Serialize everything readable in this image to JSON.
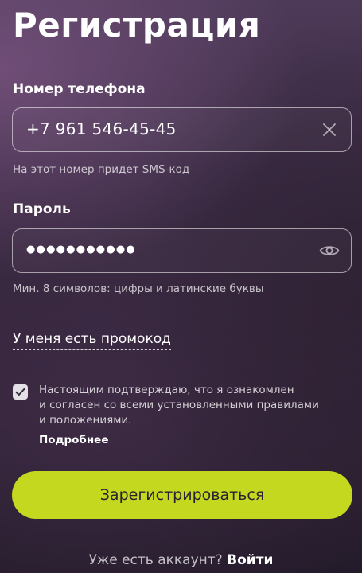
{
  "page": {
    "title": "Регистрация"
  },
  "phone": {
    "label": "Номер телефона",
    "value": "+7 961 546-45-45",
    "hint": "На этот номер придет SMS-код",
    "clear_icon": "close-icon"
  },
  "password": {
    "label": "Пароль",
    "masked_value": "●●●●●●●●●●●",
    "hint": "Мин. 8 символов: цифры и латинские буквы",
    "toggle_icon": "eye-icon"
  },
  "promo": {
    "link_label": "У меня есть промокод"
  },
  "agreement": {
    "checked": true,
    "line1": "Настоящим подтверждаю, что я ознакомлен",
    "line2": "и согласен со всеми установленными правилами",
    "line3": "и положениями.",
    "more_label": "Подробнее"
  },
  "submit": {
    "label": "Зарегистрироваться"
  },
  "footer": {
    "question": "Уже есть аккаунт?",
    "login_label": "Войти"
  },
  "colors": {
    "accent": "#c3d81f",
    "background_top": "#4d3a58",
    "background_bottom": "#221a29",
    "button_text": "#2a2230"
  }
}
